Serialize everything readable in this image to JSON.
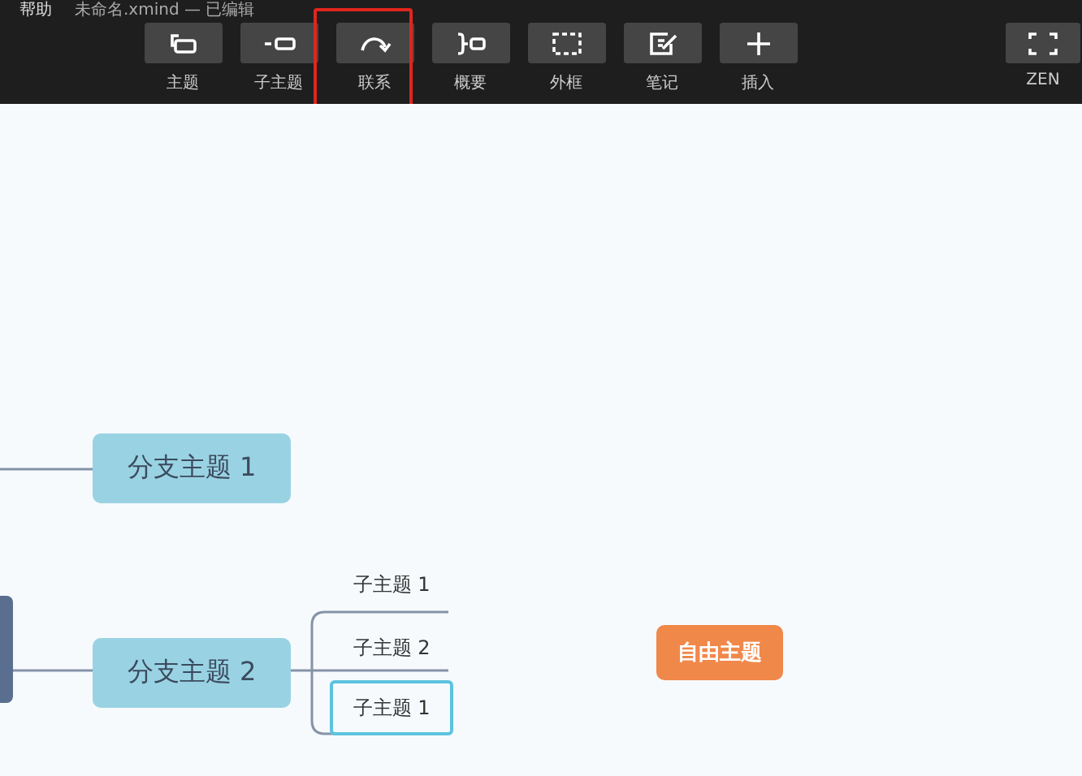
{
  "menu_bar": {
    "menu": "帮助",
    "file_title": "未命名.xmind — 已编辑"
  },
  "toolbar": [
    {
      "label": "主题",
      "highlighted": false
    },
    {
      "label": "子主题",
      "highlighted": false
    },
    {
      "label": "联系",
      "highlighted": true
    },
    {
      "label": "概要",
      "highlighted": false
    },
    {
      "label": "外框",
      "highlighted": false
    },
    {
      "label": "笔记",
      "highlighted": false
    },
    {
      "label": "插入",
      "highlighted": false
    }
  ],
  "zen": {
    "label": "ZEN"
  },
  "mindmap": {
    "branches": [
      {
        "label": "分支主题 1"
      },
      {
        "label": "分支主题 2",
        "children": [
          {
            "label": "子主题 1",
            "selected": false
          },
          {
            "label": "子主题 2",
            "selected": false
          },
          {
            "label": "子主题 1",
            "selected": true
          }
        ]
      }
    ],
    "floating_topic": {
      "label": "自由主题"
    }
  }
}
